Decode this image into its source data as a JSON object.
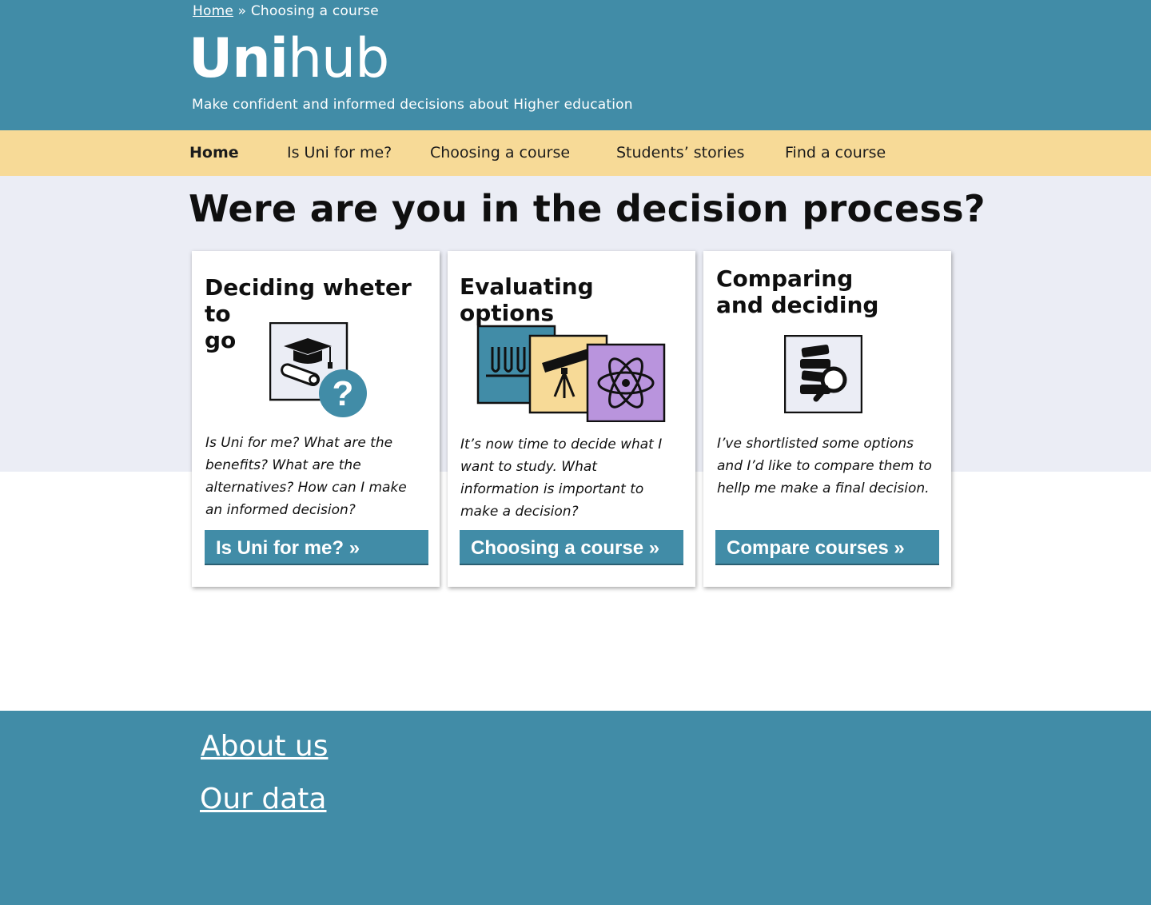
{
  "breadcrumb": {
    "home": "Home",
    "separator": "»",
    "current": "Choosing a course"
  },
  "brand": {
    "bold": "Uni",
    "light": "hub"
  },
  "tagline": "Make confident and informed decisions about Higher education",
  "nav": {
    "items": [
      {
        "label": "Home"
      },
      {
        "label": "Is Uni for me?"
      },
      {
        "label": "Choosing a course"
      },
      {
        "label": "Students’ stories"
      },
      {
        "label": "Find a course"
      }
    ]
  },
  "main": {
    "title": "Were are you in the decision process?",
    "cards": [
      {
        "title_line1": "Deciding wheter to",
        "title_line2": "go",
        "text": "Is Uni for me? What are the benefits? What are the alternatives? How can I make an informed decision?",
        "button": "Is Uni for me?  »",
        "icon": "graduation-question-icon"
      },
      {
        "title_line1": "Evaluating options",
        "text": "It’s now time to decide what I want to study. What information is important to make a decision?",
        "button": "Choosing a course »",
        "icon": "science-options-icon"
      },
      {
        "title_line1": "Comparing",
        "title_line2": "and deciding",
        "text": "I’ve shortlisted some options and I’d like to compare them to hellp me make a final decision.",
        "button": "Compare courses »",
        "icon": "books-magnifier-icon"
      }
    ]
  },
  "footer": {
    "links": [
      {
        "label": "About us"
      },
      {
        "label": "Our data"
      }
    ]
  },
  "colors": {
    "primary": "#418ca7",
    "nav_bg": "#f7da97",
    "band_bg": "#ebedf5",
    "purple": "#b994dd"
  }
}
